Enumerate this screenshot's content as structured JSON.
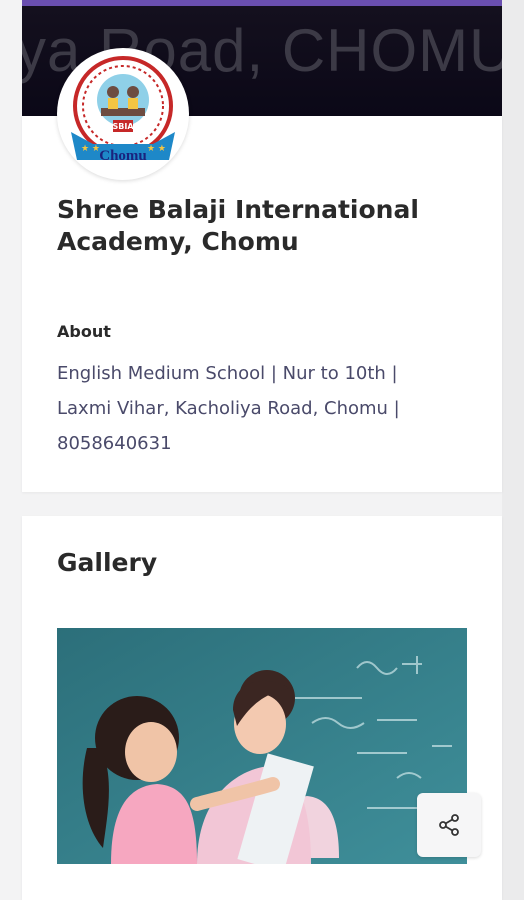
{
  "cover": {
    "text": "ya Road, CHOMU("
  },
  "logo": {
    "initials": "SBIA",
    "town": "Chomu"
  },
  "profile": {
    "name": "Shree Balaji International Academy, Chomu"
  },
  "about": {
    "label": "About",
    "text": "English Medium School | Nur to 10th | Laxmi Vihar, Kacholiya Road, Chomu | 8058640631"
  },
  "gallery": {
    "title": "Gallery"
  },
  "icons": {
    "share": "share-icon"
  },
  "colors": {
    "accent": "#6a4fb0",
    "about_text": "#4a4a6a",
    "chalkboard": "#2f7a86"
  }
}
